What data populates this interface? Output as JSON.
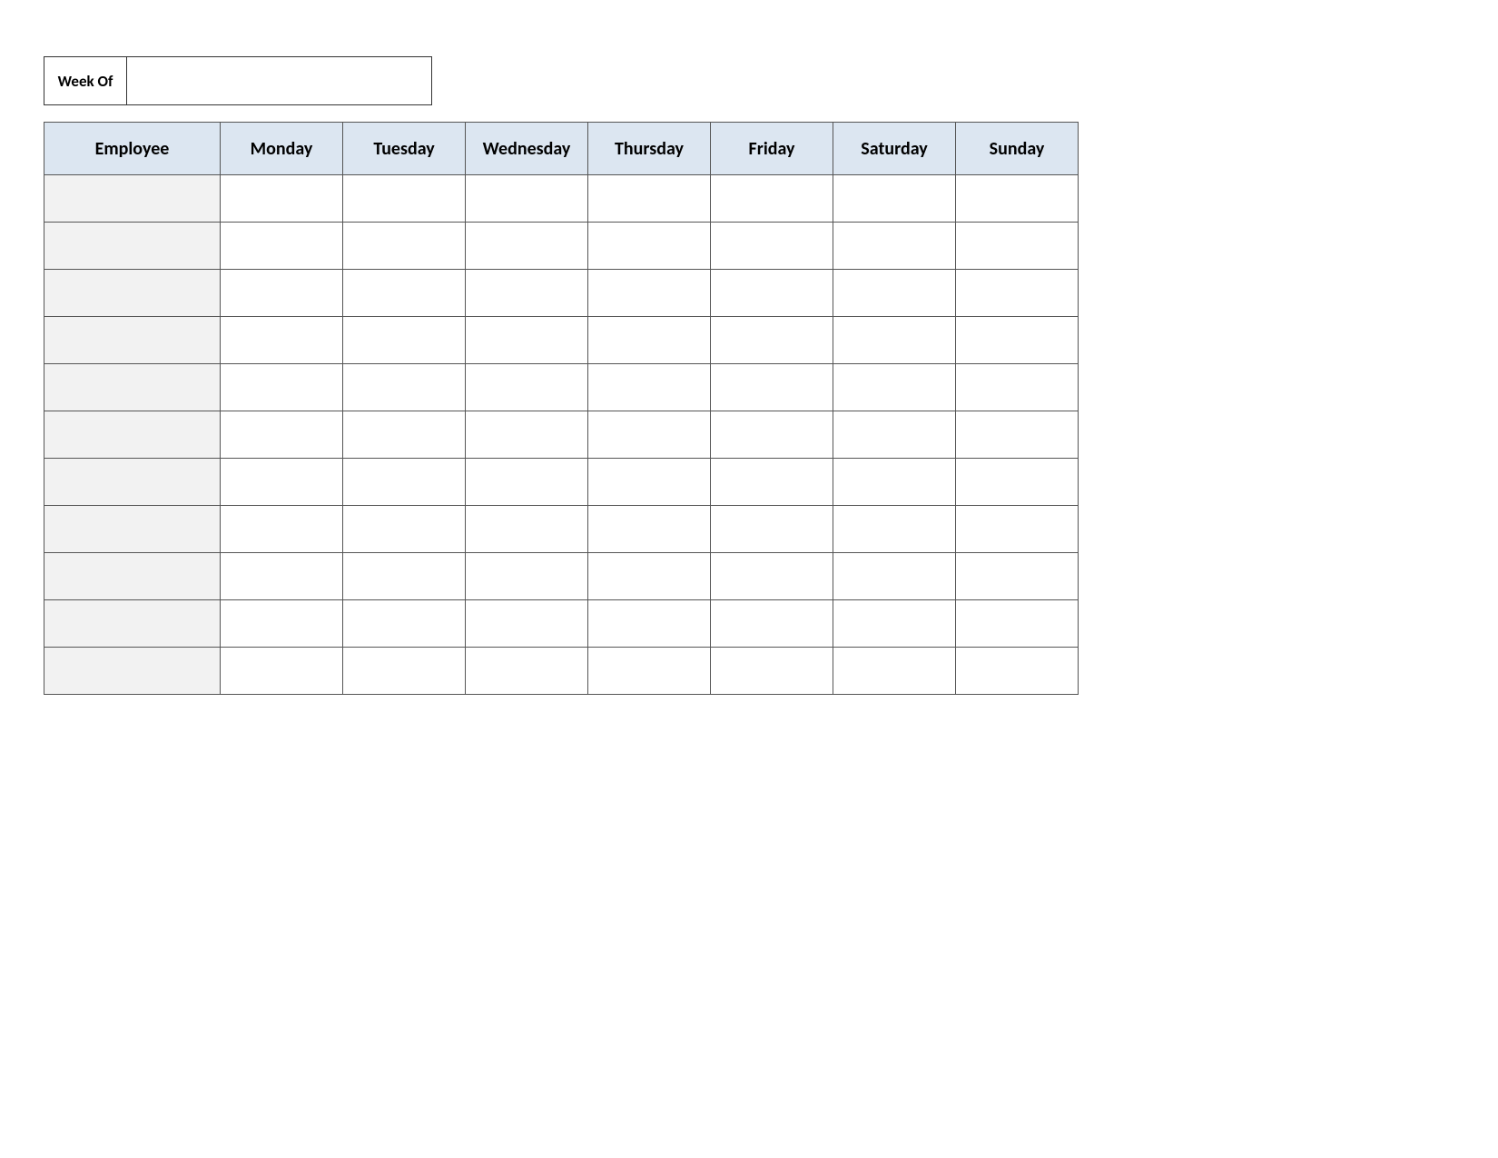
{
  "weekOf": {
    "label": "Week Of",
    "value": ""
  },
  "headers": {
    "employee": "Employee",
    "days": [
      "Monday",
      "Tuesday",
      "Wednesday",
      "Thursday",
      "Friday",
      "Saturday",
      "Sunday"
    ]
  },
  "rows": [
    {
      "employee": "",
      "mon": "",
      "tue": "",
      "wed": "",
      "thu": "",
      "fri": "",
      "sat": "",
      "sun": ""
    },
    {
      "employee": "",
      "mon": "",
      "tue": "",
      "wed": "",
      "thu": "",
      "fri": "",
      "sat": "",
      "sun": ""
    },
    {
      "employee": "",
      "mon": "",
      "tue": "",
      "wed": "",
      "thu": "",
      "fri": "",
      "sat": "",
      "sun": ""
    },
    {
      "employee": "",
      "mon": "",
      "tue": "",
      "wed": "",
      "thu": "",
      "fri": "",
      "sat": "",
      "sun": ""
    },
    {
      "employee": "",
      "mon": "",
      "tue": "",
      "wed": "",
      "thu": "",
      "fri": "",
      "sat": "",
      "sun": ""
    },
    {
      "employee": "",
      "mon": "",
      "tue": "",
      "wed": "",
      "thu": "",
      "fri": "",
      "sat": "",
      "sun": ""
    },
    {
      "employee": "",
      "mon": "",
      "tue": "",
      "wed": "",
      "thu": "",
      "fri": "",
      "sat": "",
      "sun": ""
    },
    {
      "employee": "",
      "mon": "",
      "tue": "",
      "wed": "",
      "thu": "",
      "fri": "",
      "sat": "",
      "sun": ""
    },
    {
      "employee": "",
      "mon": "",
      "tue": "",
      "wed": "",
      "thu": "",
      "fri": "",
      "sat": "",
      "sun": ""
    },
    {
      "employee": "",
      "mon": "",
      "tue": "",
      "wed": "",
      "thu": "",
      "fri": "",
      "sat": "",
      "sun": ""
    },
    {
      "employee": "",
      "mon": "",
      "tue": "",
      "wed": "",
      "thu": "",
      "fri": "",
      "sat": "",
      "sun": ""
    }
  ]
}
